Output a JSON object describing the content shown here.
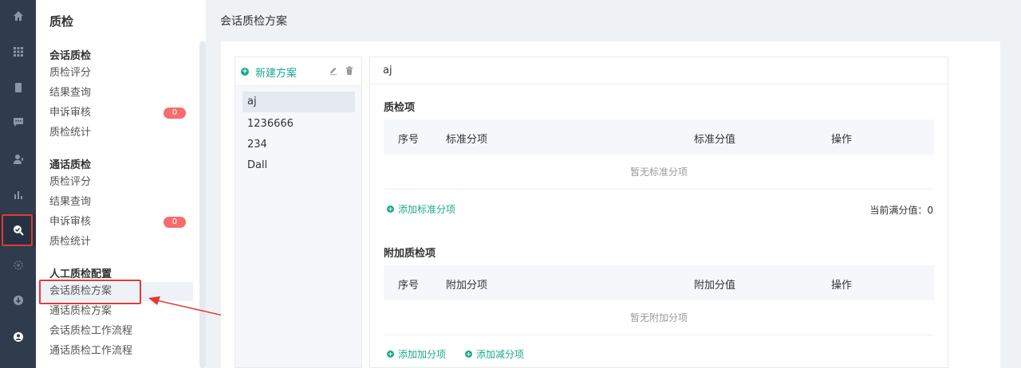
{
  "colors": {
    "rail": "#2f3c4e",
    "accent": "#1aab8a",
    "badge": "#f76c6c",
    "highlight": "#e53935"
  },
  "rail": {
    "icons": [
      "home-icon",
      "apps-grid-icon",
      "book-icon",
      "message-icon",
      "user-headset-icon",
      "bar-chart-icon",
      "quality-check-icon",
      "settings-icon",
      "download-icon",
      "account-icon"
    ],
    "active": "quality-check-icon"
  },
  "subnav": {
    "title": "质检",
    "groups": [
      {
        "title": "会话质检",
        "items": [
          {
            "label": "质检评分"
          },
          {
            "label": "结果查询"
          },
          {
            "label": "申诉审核",
            "badge": "0"
          },
          {
            "label": "质检统计"
          }
        ]
      },
      {
        "title": "通话质检",
        "items": [
          {
            "label": "质检评分"
          },
          {
            "label": "结果查询"
          },
          {
            "label": "申诉审核",
            "badge": "0"
          },
          {
            "label": "质检统计"
          }
        ]
      },
      {
        "title": "人工质检配置",
        "items": [
          {
            "label": "会话质检方案",
            "selected": true
          },
          {
            "label": "通话质检方案"
          },
          {
            "label": "会话质检工作流程"
          },
          {
            "label": "通话质检工作流程"
          }
        ]
      }
    ]
  },
  "page": {
    "title": "会话质检方案"
  },
  "plans": {
    "new_label": "新建方案",
    "items": [
      "aj",
      "1236666",
      "234",
      "Dall"
    ],
    "selected": "aj"
  },
  "detail": {
    "name": "aj",
    "standard": {
      "title": "质检项",
      "columns": {
        "index": "序号",
        "item": "标准分项",
        "value": "标准分值",
        "action": "操作"
      },
      "empty": "暂无标准分项",
      "add_label": "添加标准分项",
      "score_label": "当前满分值：",
      "score_value": "0"
    },
    "extra": {
      "title": "附加质检项",
      "columns": {
        "index": "序号",
        "item": "附加分项",
        "value": "附加分值",
        "action": "操作"
      },
      "empty": "暂无附加分项",
      "add_plus_label": "添加加分项",
      "add_minus_label": "添加减分项"
    }
  }
}
